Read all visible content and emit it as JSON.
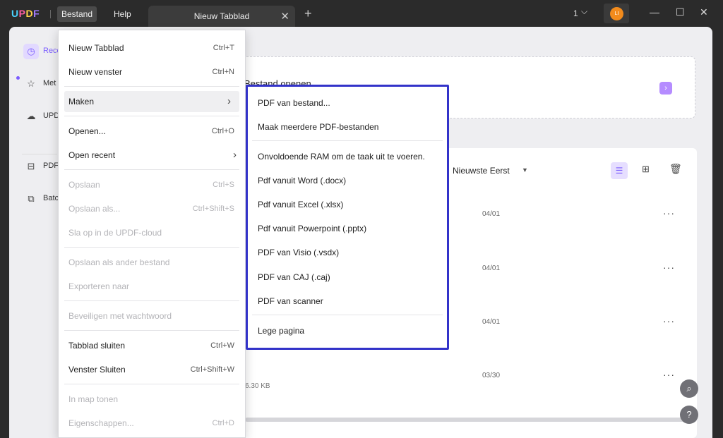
{
  "titlebar": {
    "logo": {
      "u": "U",
      "p": "P",
      "d": "D",
      "f": "F"
    },
    "menus": [
      "Bestand",
      "Help"
    ],
    "tab": {
      "label": "Nieuw Tabblad"
    },
    "window_count": "1",
    "avatar_initials": "LI"
  },
  "sidebar": {
    "items": [
      {
        "label": "Recent",
        "icon": "clock-icon"
      },
      {
        "label": "Met ster",
        "icon": "star-icon"
      },
      {
        "label": "UPDF Cloud",
        "icon": "cloud-icon"
      },
      {
        "label": "PDF",
        "icon": "briefcase-icon"
      },
      {
        "label": "Batch",
        "icon": "layers-icon"
      }
    ]
  },
  "main": {
    "open_title": "Bestand openen",
    "sort_label": "Nieuwste Eerst",
    "files": [
      {
        "date": "04/01"
      },
      {
        "date": "04/01"
      },
      {
        "date": "04/01"
      },
      {
        "date": "03/30",
        "size": "6.30 KB"
      }
    ]
  },
  "file_menu": {
    "items": [
      {
        "label": "Nieuw Tabblad",
        "shortcut": "Ctrl+T",
        "disabled": false
      },
      {
        "label": "Nieuw venster",
        "shortcut": "Ctrl+N",
        "disabled": false
      },
      {
        "label": "Maken",
        "shortcut": "",
        "disabled": false
      },
      {
        "label": "Openen...",
        "shortcut": "Ctrl+O",
        "disabled": false
      },
      {
        "label": "Open recent",
        "shortcut": "",
        "disabled": false
      },
      {
        "label": "Opslaan",
        "shortcut": "Ctrl+S",
        "disabled": true
      },
      {
        "label": "Opslaan als...",
        "shortcut": "Ctrl+Shift+S",
        "disabled": true
      },
      {
        "label": "Sla op in de UPDF-cloud",
        "shortcut": "",
        "disabled": true
      },
      {
        "label": "Opslaan als ander bestand",
        "shortcut": "",
        "disabled": true
      },
      {
        "label": "Exporteren naar",
        "shortcut": "",
        "disabled": true
      },
      {
        "label": "Beveiligen met wachtwoord",
        "shortcut": "",
        "disabled": true
      },
      {
        "label": "Tabblad sluiten",
        "shortcut": "Ctrl+W",
        "disabled": false
      },
      {
        "label": "Venster Sluiten",
        "shortcut": "Ctrl+Shift+W",
        "disabled": false
      },
      {
        "label": "In map tonen",
        "shortcut": "",
        "disabled": true
      },
      {
        "label": "Eigenschappen...",
        "shortcut": "Ctrl+D",
        "disabled": true
      }
    ]
  },
  "create_submenu": {
    "items": [
      "PDF van bestand...",
      "Maak meerdere PDF-bestanden",
      "Onvoldoende RAM om de taak uit te voeren.",
      "Pdf vanuit Word (.docx)",
      "Pdf vanuit Excel (.xlsx)",
      "Pdf vanuit Powerpoint (.pptx)",
      "PDF van Visio (.vsdx)",
      "PDF van CAJ (.caj)",
      "PDF van scanner",
      "Lege pagina"
    ]
  },
  "colors": {
    "accent": "#7b5cff",
    "submenu_border": "#3333c9"
  }
}
